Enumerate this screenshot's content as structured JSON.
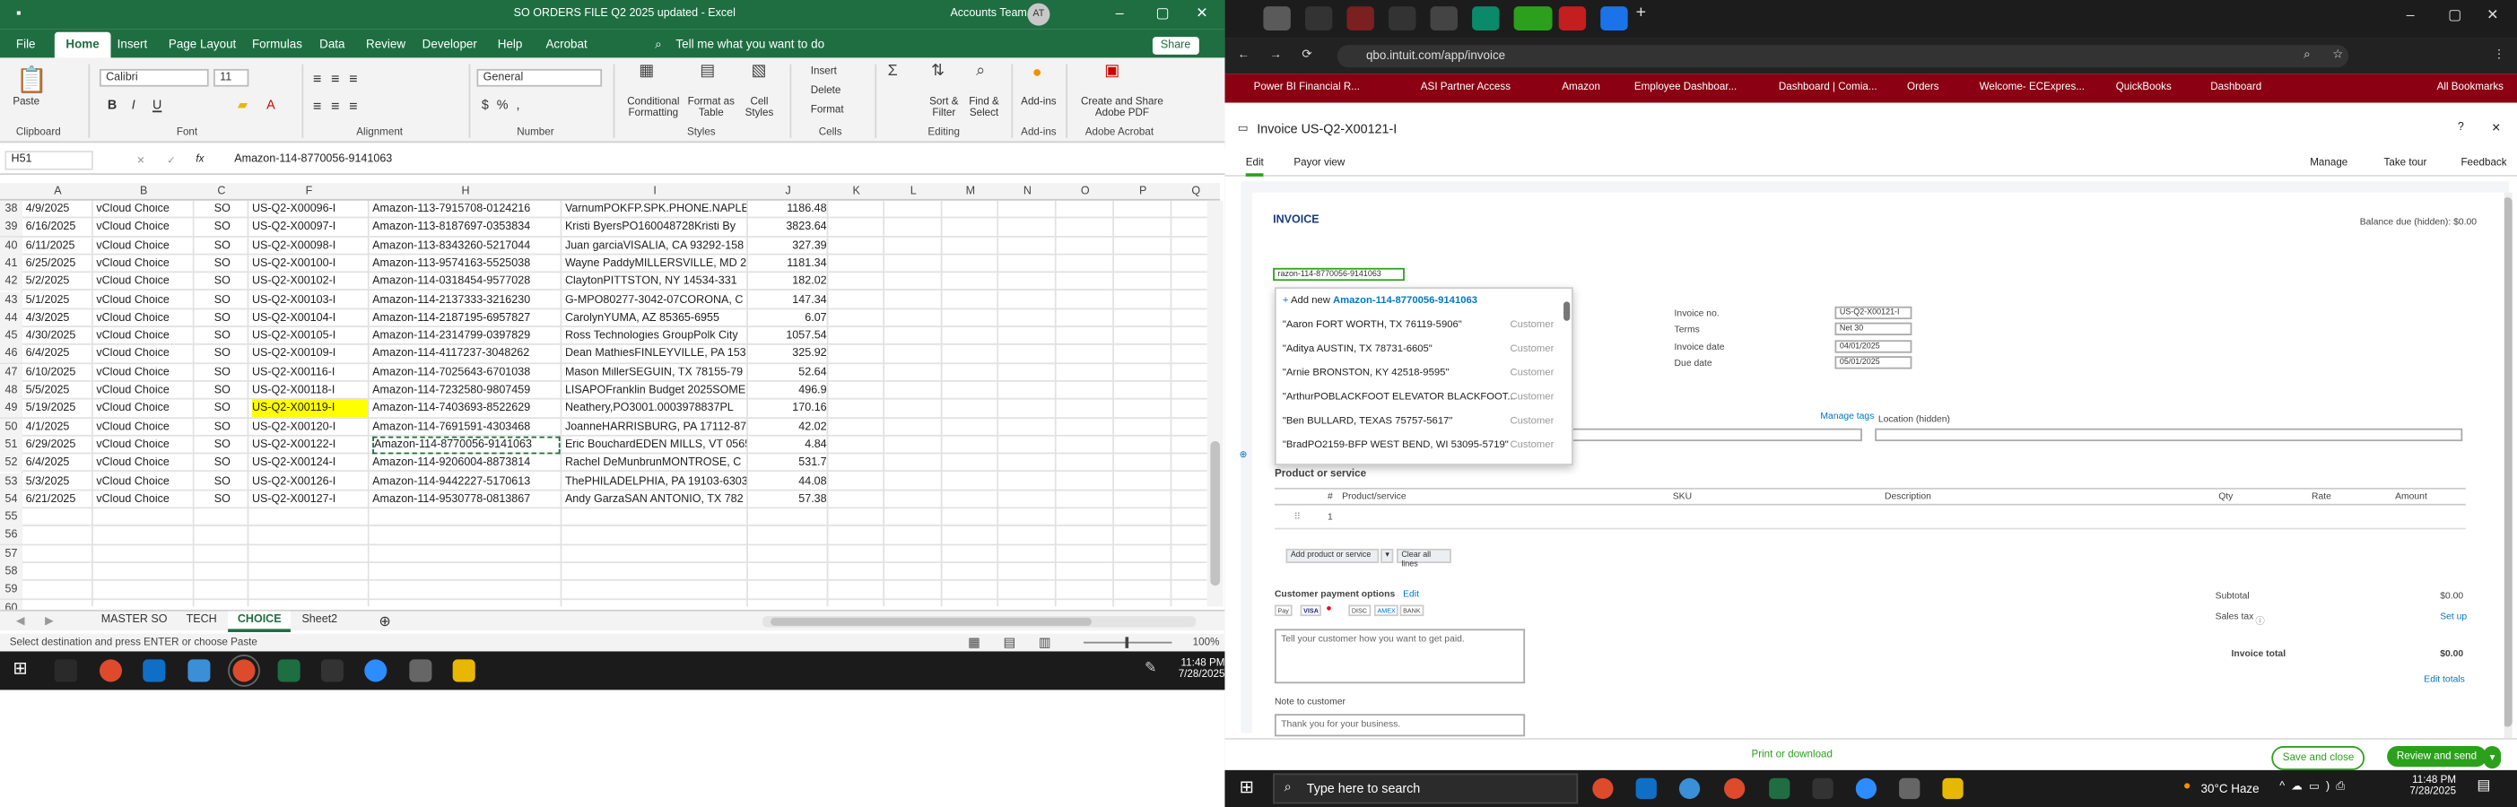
{
  "excel": {
    "title": "SO ORDERS FILE Q2 2025 updated  -  Excel",
    "account": "Accounts Team",
    "avatar": "AT",
    "tabs": [
      "File",
      "Home",
      "Insert",
      "Page Layout",
      "Formulas",
      "Data",
      "Review",
      "Developer",
      "Help",
      "Acrobat",
      "Tell me what you want to do"
    ],
    "share": "Share",
    "ribbon": {
      "paste": "Paste",
      "clipboard": "Clipboard",
      "font_name": "Calibri",
      "font_size": "11",
      "font": "Font",
      "alignment": "Alignment",
      "number_format": "General",
      "number": "Number",
      "conditional": "Conditional Formatting",
      "format_table": "Format as Table",
      "cell_styles": "Cell Styles",
      "styles": "Styles",
      "insert": "Insert",
      "delete": "Delete",
      "format": "Format",
      "cells": "Cells",
      "sort": "Sort & Filter",
      "find": "Find & Select",
      "editing": "Editing",
      "addins": "Add-ins",
      "acrobat_btn": "Create and Share Adobe PDF",
      "adobe": "Adobe Acrobat"
    },
    "name_box": "H51",
    "formula": "Amazon-114-8770056-9141063",
    "columns": [
      "A",
      "B",
      "C",
      "F",
      "H",
      "I",
      "J",
      "K",
      "L",
      "M",
      "N",
      "O",
      "P",
      "Q"
    ],
    "rows": [
      {
        "n": "38",
        "a": "4/9/2025",
        "b": "vCloud Choice",
        "c": "SO",
        "f": "US-Q2-X00096-I",
        "h": "Amazon-113-7915708-0124216",
        "i": "VarnumPOKFP.SPK.PHONE.NAPLE",
        "j": "1186.48"
      },
      {
        "n": "39",
        "a": "6/16/2025",
        "b": "vCloud Choice",
        "c": "SO",
        "f": "US-Q2-X00097-I",
        "h": "Amazon-113-8187697-0353834",
        "i": "Kristi ByersPO160048728Kristi By",
        "j": "3823.64"
      },
      {
        "n": "40",
        "a": "6/11/2025",
        "b": "vCloud Choice",
        "c": "SO",
        "f": "US-Q2-X00098-I",
        "h": "Amazon-113-8343260-5217044",
        "i": "Juan garciaVISALIA, CA 93292-158",
        "j": "327.39"
      },
      {
        "n": "41",
        "a": "6/25/2025",
        "b": "vCloud Choice",
        "c": "SO",
        "f": "US-Q2-X00100-I",
        "h": "Amazon-113-9574163-5525038",
        "i": "Wayne PaddyMILLERSVILLE, MD 2",
        "j": "1181.34"
      },
      {
        "n": "42",
        "a": "5/2/2025",
        "b": "vCloud Choice",
        "c": "SO",
        "f": "US-Q2-X00102-I",
        "h": "Amazon-114-0318454-9577028",
        "i": "ClaytonPITTSTON, NY 14534-331",
        "j": "182.02"
      },
      {
        "n": "43",
        "a": "5/1/2025",
        "b": "vCloud Choice",
        "c": "SO",
        "f": "US-Q2-X00103-I",
        "h": "Amazon-114-2137333-3216230",
        "i": "G-MPO80277-3042-07CORONA, C",
        "j": "147.34"
      },
      {
        "n": "44",
        "a": "4/3/2025",
        "b": "vCloud Choice",
        "c": "SO",
        "f": "US-Q2-X00104-I",
        "h": "Amazon-114-2187195-6957827",
        "i": "CarolynYUMA, AZ 85365-6955",
        "j": "6.07"
      },
      {
        "n": "45",
        "a": "4/30/2025",
        "b": "vCloud Choice",
        "c": "SO",
        "f": "US-Q2-X00105-I",
        "h": "Amazon-114-2314799-0397829",
        "i": "Ross Technologies GroupPolk City",
        "j": "1057.54"
      },
      {
        "n": "46",
        "a": "6/4/2025",
        "b": "vCloud Choice",
        "c": "SO",
        "f": "US-Q2-X00109-I",
        "h": "Amazon-114-4117237-3048262",
        "i": "Dean MathiesFINLEYVILLE, PA 153",
        "j": "325.92"
      },
      {
        "n": "47",
        "a": "6/10/2025",
        "b": "vCloud Choice",
        "c": "SO",
        "f": "US-Q2-X00116-I",
        "h": "Amazon-114-7025643-6701038",
        "i": "Mason MillerSEGUIN, TX 78155-79",
        "j": "52.64"
      },
      {
        "n": "48",
        "a": "5/5/2025",
        "b": "vCloud Choice",
        "c": "SO",
        "f": "US-Q2-X00118-I",
        "h": "Amazon-114-7232580-9807459",
        "i": "LISAPOFranklin Budget 2025SOME",
        "j": "496.9"
      },
      {
        "n": "49",
        "a": "5/19/2025",
        "b": "vCloud Choice",
        "c": "SO",
        "f": "US-Q2-X00119-I",
        "h": "Amazon-114-7403693-8522629",
        "i": "Neathery,PO3001.0003978837PL",
        "j": "170.16",
        "hl": true
      },
      {
        "n": "50",
        "a": "4/1/2025",
        "b": "vCloud Choice",
        "c": "SO",
        "f": "US-Q2-X00120-I",
        "h": "Amazon-114-7691591-4303468",
        "i": "JoanneHARRISBURG, PA 17112-87",
        "j": "42.02"
      },
      {
        "n": "51",
        "a": "6/29/2025",
        "b": "vCloud Choice",
        "c": "SO",
        "f": "US-Q2-X00122-I",
        "h": "Amazon-114-8770056-9141063",
        "i": "Eric BouchardEDEN MILLS, VT 0565",
        "j": "4.84",
        "sel": true
      },
      {
        "n": "52",
        "a": "6/4/2025",
        "b": "vCloud Choice",
        "c": "SO",
        "f": "US-Q2-X00124-I",
        "h": "Amazon-114-9206004-8873814",
        "i": "Rachel DeMunbrunMONTROSE, C",
        "j": "531.7"
      },
      {
        "n": "53",
        "a": "5/3/2025",
        "b": "vCloud Choice",
        "c": "SO",
        "f": "US-Q2-X00126-I",
        "h": "Amazon-114-9442227-5170613",
        "i": "ThePHILADELPHIA, PA 19103-6303",
        "j": "44.08"
      },
      {
        "n": "54",
        "a": "6/21/2025",
        "b": "vCloud Choice",
        "c": "SO",
        "f": "US-Q2-X00127-I",
        "h": "Amazon-114-9530778-0813867",
        "i": "Andy GarzaSAN ANTONIO, TX 782",
        "j": "57.38"
      },
      {
        "n": "55"
      },
      {
        "n": "56"
      },
      {
        "n": "57"
      },
      {
        "n": "58"
      },
      {
        "n": "59"
      },
      {
        "n": "60"
      }
    ],
    "sheets": [
      "MASTER SO",
      "TECH",
      "CHOICE",
      "Sheet2"
    ],
    "status": "Select destination and press ENTER or choose Paste",
    "zoom": "100%",
    "time": "11:48 PM",
    "date": "7/28/2025"
  },
  "browser": {
    "url": "qbo.intuit.com/app/invoice",
    "bookmarks": [
      "Power BI Financial R...",
      "ASI Partner Access",
      "Amazon",
      "Employee Dashboar...",
      "Dashboard | Comia...",
      "Orders",
      "Welcome- ECExpres...",
      "QuickBooks",
      "Dashboard",
      "All Bookmarks"
    ],
    "invoice_header": "Invoice US-Q2-X00121-I",
    "tabs": [
      "Edit",
      "Payor view"
    ],
    "actions": [
      "Manage",
      "Take tour",
      "Feedback"
    ],
    "invoice_label": "INVOICE",
    "balance_due": "Balance due (hidden): $0.00",
    "customer_input": "razon-114-8770056-9141063",
    "add_new_label": "Add new",
    "add_new_value": "Amazon-114-8770056-9141063",
    "customers": [
      {
        "name": "\"Aaron FORT WORTH, TX 76119-5906\"",
        "type": "Customer"
      },
      {
        "name": "\"Aditya AUSTIN, TX 78731-6605\"",
        "type": "Customer"
      },
      {
        "name": "\"Arnie BRONSTON, KY 42518-9595\"",
        "type": "Customer"
      },
      {
        "name": "\"ArthurPOBLACKFOOT ELEVATOR BLACKFOOT...",
        "type": "Customer"
      },
      {
        "name": "\"Ben BULLARD, TEXAS 75757-5617\"",
        "type": "Customer"
      },
      {
        "name": "\"BradPO2159-BFP WEST BEND, WI 53095-5719\"",
        "type": "Customer"
      }
    ],
    "invoice_no_label": "Invoice no.",
    "invoice_no": "US-Q2-X00121-I",
    "terms_label": "Terms",
    "terms": "Net 30",
    "invoice_date_label": "Invoice date",
    "invoice_date": "04/01/2025",
    "due_date_label": "Due date",
    "due_date": "05/01/2025",
    "manage_tags": "Manage tags",
    "location_label": "Location (hidden)",
    "product_section": "Product or service",
    "table_headers": [
      "#",
      "Product/service",
      "SKU",
      "Description",
      "Qty",
      "Rate",
      "Amount"
    ],
    "line1": "1",
    "add_product": "Add product or service",
    "clear_lines": "Clear all lines",
    "payment_options": "Customer payment options",
    "edit": "Edit",
    "pay_logos": [
      "Pay",
      "VISA",
      "MC",
      "DISC",
      "AMEX",
      "BANK"
    ],
    "customer_msg": "Tell your customer how you want to get paid.",
    "note_label": "Note to customer",
    "note_text": "Thank you for your business.",
    "subtotal_label": "Subtotal",
    "subtotal": "$0.00",
    "sales_tax_label": "Sales tax",
    "setup": "Set up",
    "total_label": "Invoice total",
    "total": "$0.00",
    "edit_totals": "Edit totals",
    "print": "Print or download",
    "save_close": "Save and close",
    "review_send": "Review and send",
    "search": "Type here to search",
    "weather": "30°C Haze",
    "time": "11:48 PM",
    "date": "7/28/2025"
  }
}
